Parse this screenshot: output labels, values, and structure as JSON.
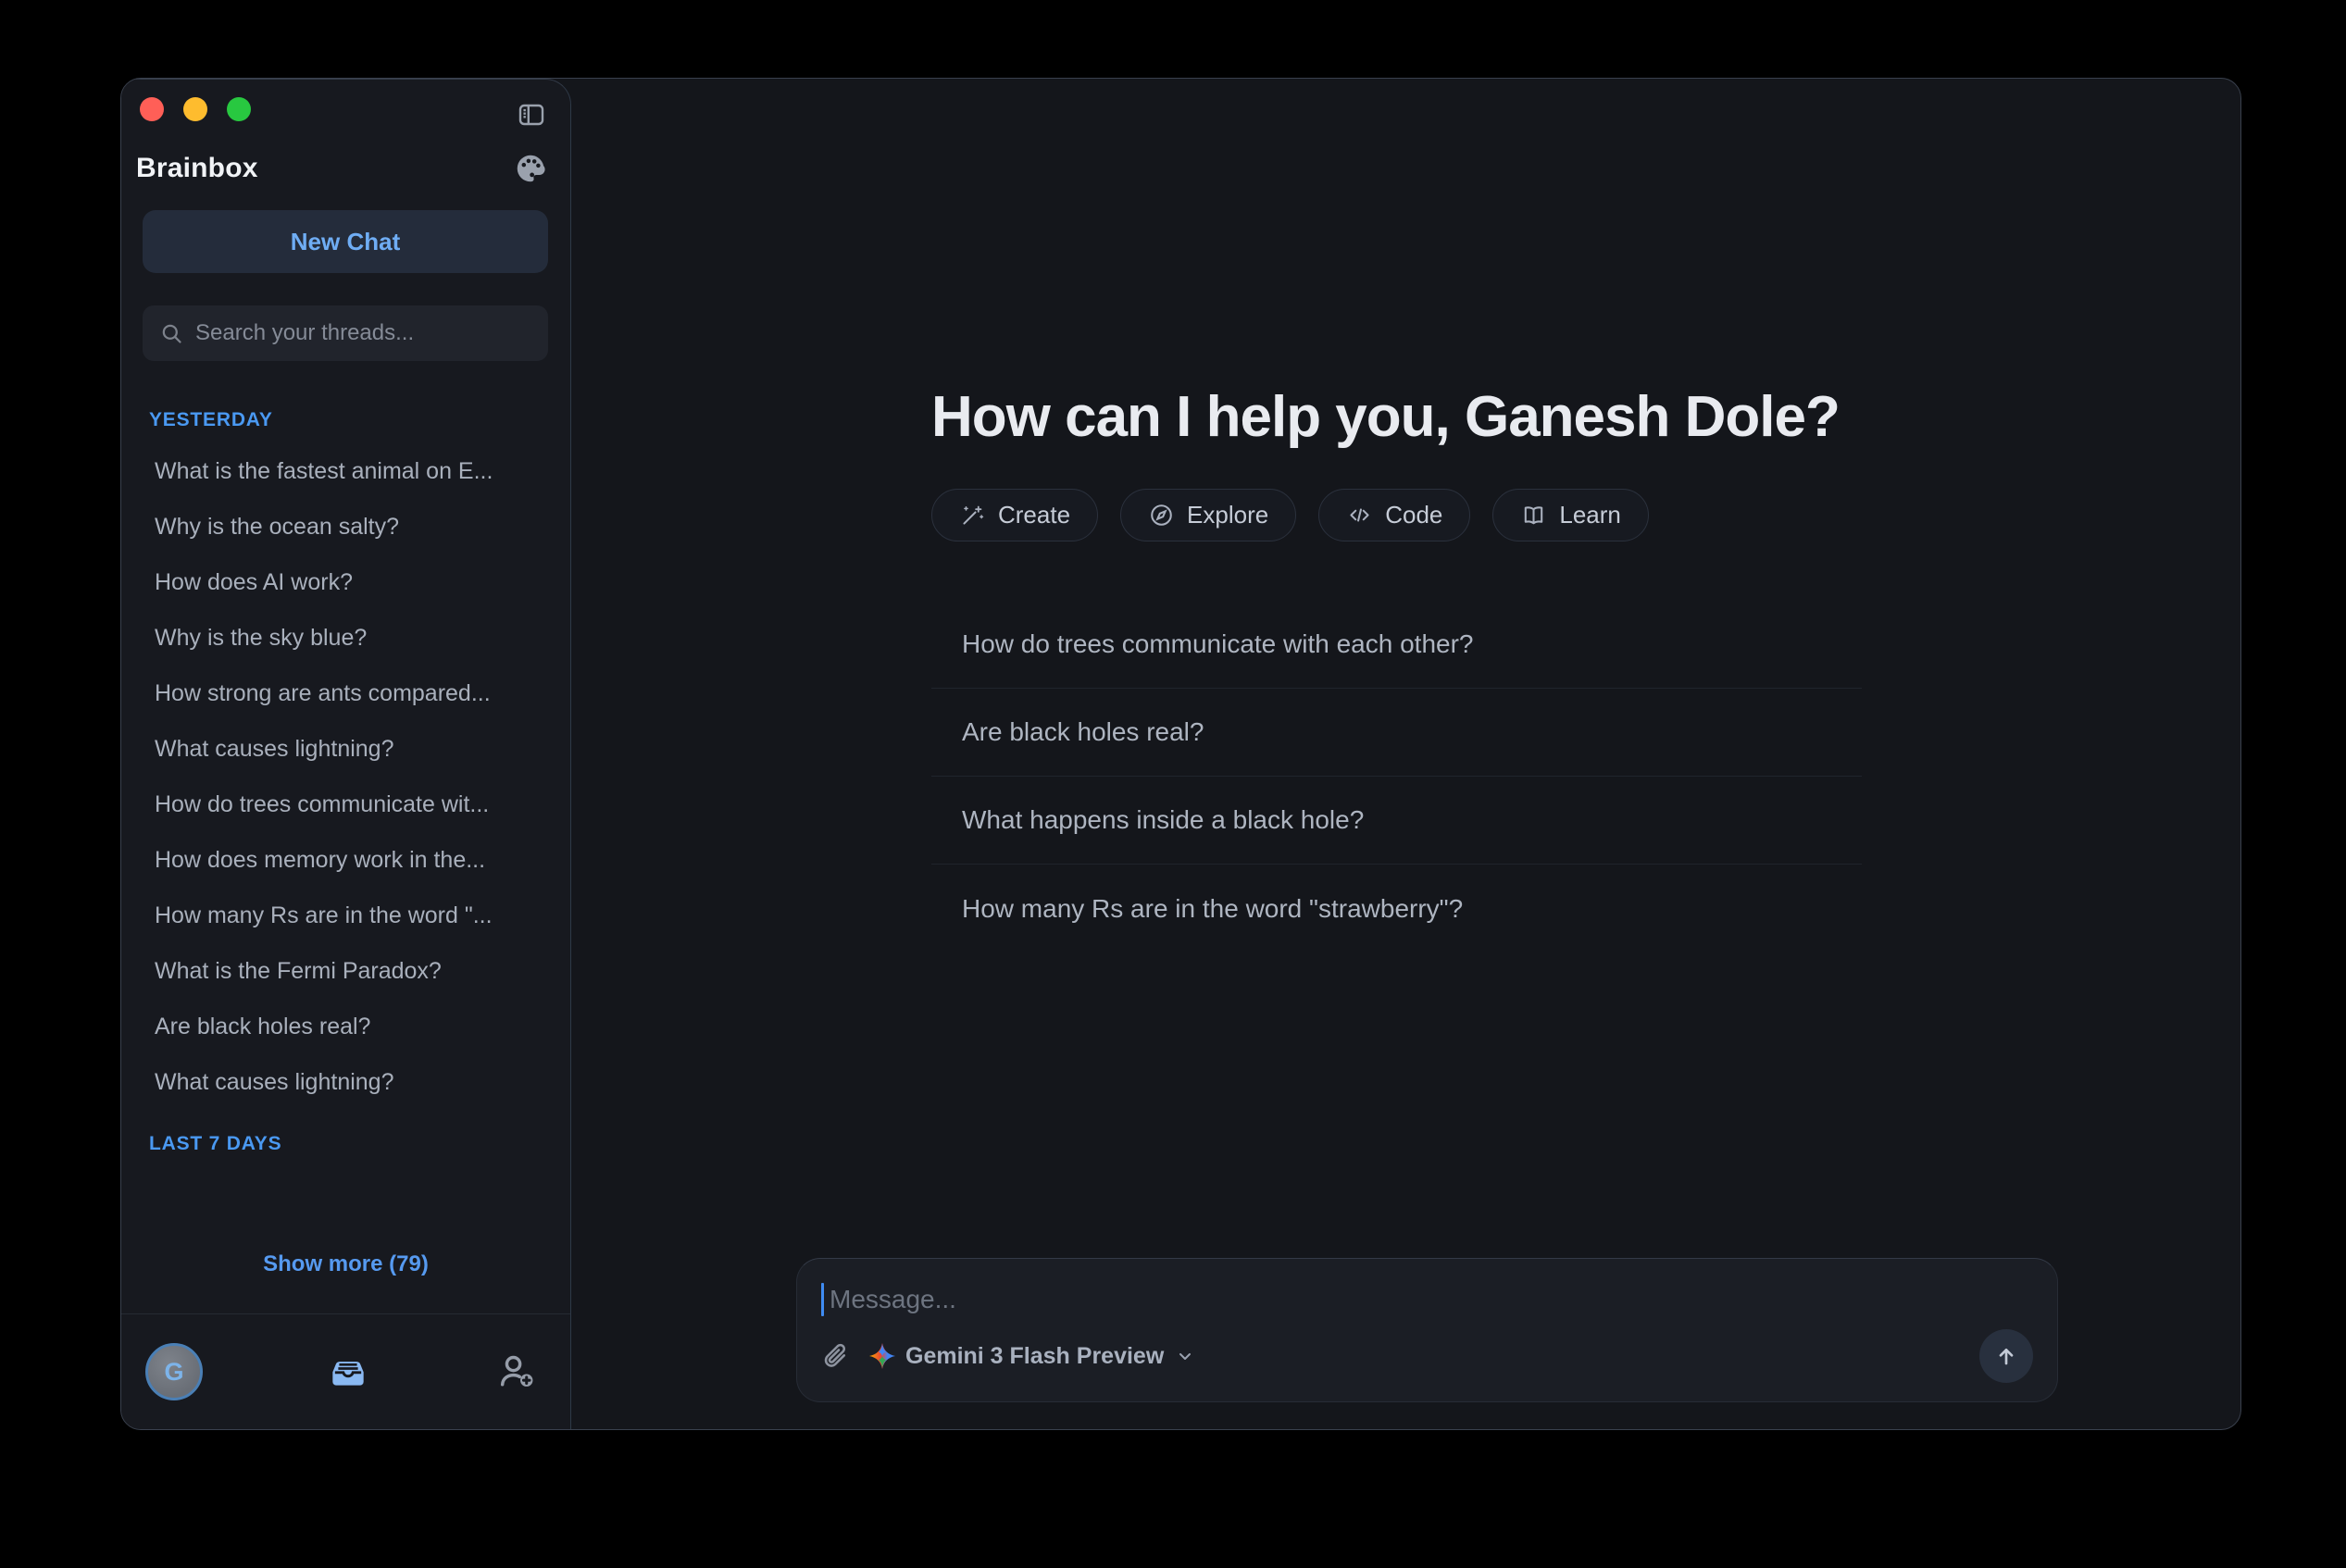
{
  "window": {
    "controls": {
      "close": "close",
      "minimize": "minimize",
      "zoom": "zoom"
    }
  },
  "sidebar": {
    "title": "Brainbox",
    "new_chat_label": "New Chat",
    "search_placeholder": "Search your threads...",
    "section_yesterday": "YESTERDAY",
    "section_last7days": "LAST 7 DAYS",
    "threads": [
      "What is the fastest animal on E...",
      "Why is the ocean salty?",
      "How does AI work?",
      "Why is the sky blue?",
      "How strong are ants compared...",
      "What causes lightning?",
      "How do trees communicate wit...",
      "How does memory work in the...",
      "How many Rs are in the word \"...",
      "What is the Fermi Paradox?",
      "Are black holes real?",
      "What causes lightning?"
    ],
    "show_more_label": "Show more (79)",
    "avatar_initial": "G",
    "footer_icons": [
      "avatar",
      "archive-tray-icon",
      "add-person-icon"
    ]
  },
  "main": {
    "greeting": "How can I help you, Ganesh Dole?",
    "actions": [
      {
        "label": "Create",
        "icon": "wand-sparkles-icon"
      },
      {
        "label": "Explore",
        "icon": "compass-icon"
      },
      {
        "label": "Code",
        "icon": "code-icon"
      },
      {
        "label": "Learn",
        "icon": "book-icon"
      }
    ],
    "suggestions": [
      "How do trees communicate with each other?",
      "Are black holes real?",
      "What happens inside a black hole?",
      "How many Rs are in the word \"strawberry\"?"
    ]
  },
  "composer": {
    "placeholder": "Message...",
    "model_label": "Gemini 3 Flash Preview",
    "model_icon": "gemini-sparkle-icon",
    "attach_icon": "paperclip-icon",
    "send_icon": "arrow-up-icon"
  },
  "colors": {
    "traffic_red": "#ff5f57",
    "traffic_yellow": "#febc2e",
    "traffic_green": "#28c840",
    "accent_blue": "#4a99f2",
    "new_chat_text": "#6fadf4",
    "sidebar_bg": "#17191f",
    "main_bg": "#14161b",
    "archive_icon_blue": "#8ab9f2"
  }
}
